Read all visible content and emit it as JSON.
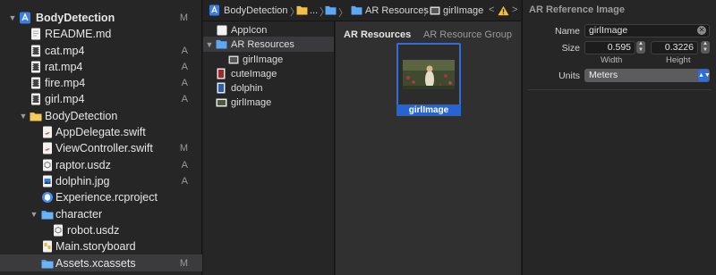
{
  "navigator": {
    "items": [
      {
        "label": "BodyDetection",
        "badge": "M",
        "icon": "project-icon"
      },
      {
        "label": "README.md",
        "badge": "",
        "icon": "text-file-icon"
      },
      {
        "label": "cat.mp4",
        "badge": "A",
        "icon": "video-file-icon"
      },
      {
        "label": "rat.mp4",
        "badge": "A",
        "icon": "video-file-icon"
      },
      {
        "label": "fire.mp4",
        "badge": "A",
        "icon": "video-file-icon"
      },
      {
        "label": "girl.mp4",
        "badge": "A",
        "icon": "video-file-icon"
      },
      {
        "label": "BodyDetection",
        "badge": "",
        "icon": "folder-icon"
      },
      {
        "label": "AppDelegate.swift",
        "badge": "",
        "icon": "swift-file-icon"
      },
      {
        "label": "ViewController.swift",
        "badge": "M",
        "icon": "swift-file-icon"
      },
      {
        "label": "raptor.usdz",
        "badge": "A",
        "icon": "usdz-file-icon"
      },
      {
        "label": "dolphin.jpg",
        "badge": "A",
        "icon": "image-file-icon"
      },
      {
        "label": "Experience.rcproject",
        "badge": "",
        "icon": "rcproject-icon"
      },
      {
        "label": "character",
        "badge": "",
        "icon": "folder-icon"
      },
      {
        "label": "robot.usdz",
        "badge": "",
        "icon": "usdz-file-icon"
      },
      {
        "label": "Main.storyboard",
        "badge": "",
        "icon": "storyboard-icon"
      },
      {
        "label": "Assets.xcassets",
        "badge": "M",
        "icon": "assets-folder-icon"
      }
    ]
  },
  "jumpbar": {
    "project": "BodyDetection",
    "ellipsis": "...",
    "group": "AR Resources",
    "item": "girlImage"
  },
  "assets": {
    "items": [
      {
        "label": "AppIcon"
      },
      {
        "label": "AR Resources"
      },
      {
        "label": "girlImage"
      },
      {
        "label": "cuteImage"
      },
      {
        "label": "dolphin"
      },
      {
        "label": "girlImage"
      }
    ]
  },
  "canvas": {
    "title": "AR Resources",
    "subtitle": "AR Resource Group",
    "tile_label": "girlImage"
  },
  "inspector": {
    "title": "AR Reference Image",
    "name_label": "Name",
    "name_value": "girlImage",
    "size_label": "Size",
    "width_value": "0.595",
    "height_value": "0.3226",
    "width_label": "Width",
    "height_label": "Height",
    "units_label": "Units",
    "units_value": "Meters"
  },
  "colors": {
    "accent": "#2564d2",
    "folder": "#5ea7f5",
    "swift": "#f05138",
    "warning": "#f5c12e"
  }
}
